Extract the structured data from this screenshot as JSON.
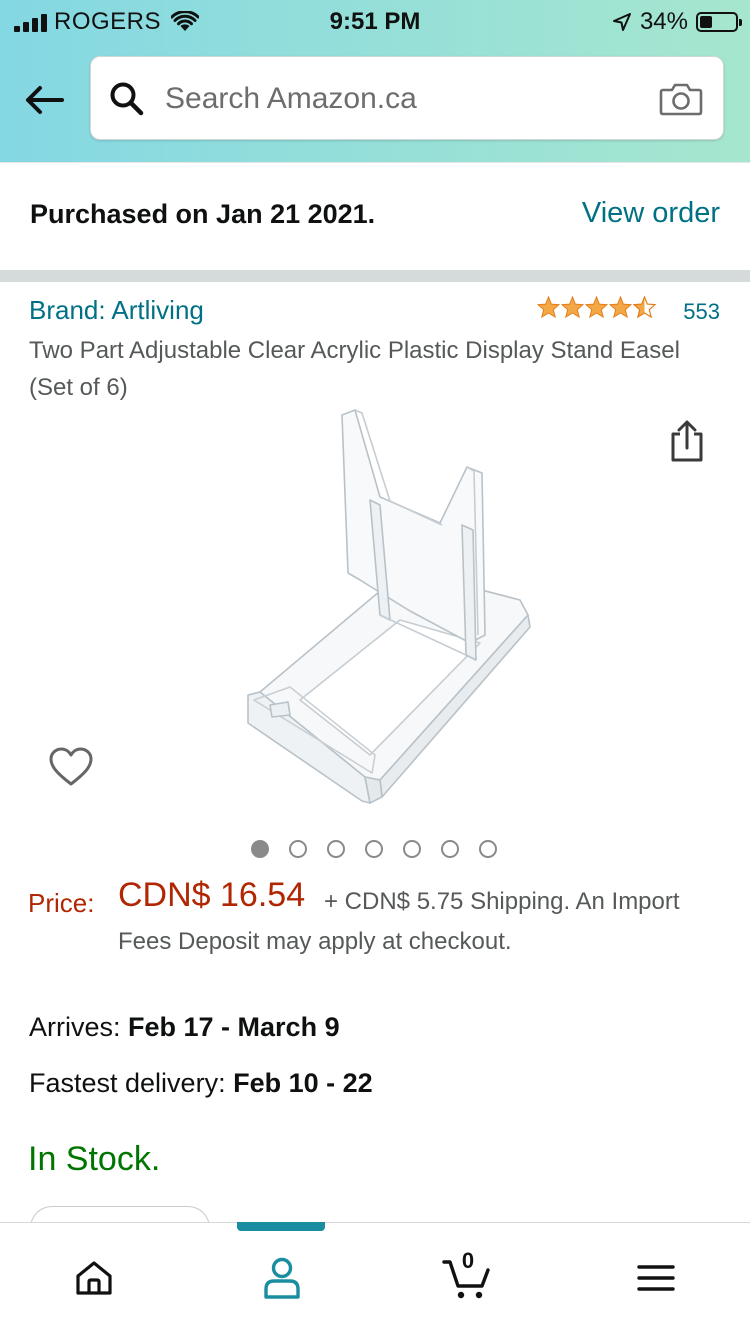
{
  "status_bar": {
    "carrier": "ROGERS",
    "time": "9:51 PM",
    "battery": "34%"
  },
  "search": {
    "placeholder": "Search Amazon.ca"
  },
  "purchase": {
    "text": "Purchased on Jan 21 2021.",
    "view_order_label": "View order"
  },
  "product": {
    "brand": "Brand: Artliving",
    "rating": 4.5,
    "rating_count": "553",
    "title": "Two Part Adjustable Clear Acrylic Plastic Display Stand Easel (Set of 6)",
    "image_count": 7,
    "active_image": 1
  },
  "pricing": {
    "label": "Price:",
    "price": "CDN$ 16.54",
    "shipping_line1": "+ CDN$ 5.75 Shipping. An Import",
    "shipping_line2": "Fees Deposit may apply at checkout."
  },
  "delivery": {
    "arrives_label": "Arrives: ",
    "arrives_value": "Feb 17 - March 9",
    "fastest_label": "Fastest delivery: ",
    "fastest_value": "Feb 10 - 22"
  },
  "stock": {
    "status": "In Stock."
  },
  "tabbar": {
    "cart_count": "0",
    "active_tab": "me"
  },
  "colors": {
    "link": "#007185",
    "price": "#b12704",
    "in_stock": "#007600",
    "star": "#f3a847",
    "tab_accent": "#1a8da0"
  }
}
